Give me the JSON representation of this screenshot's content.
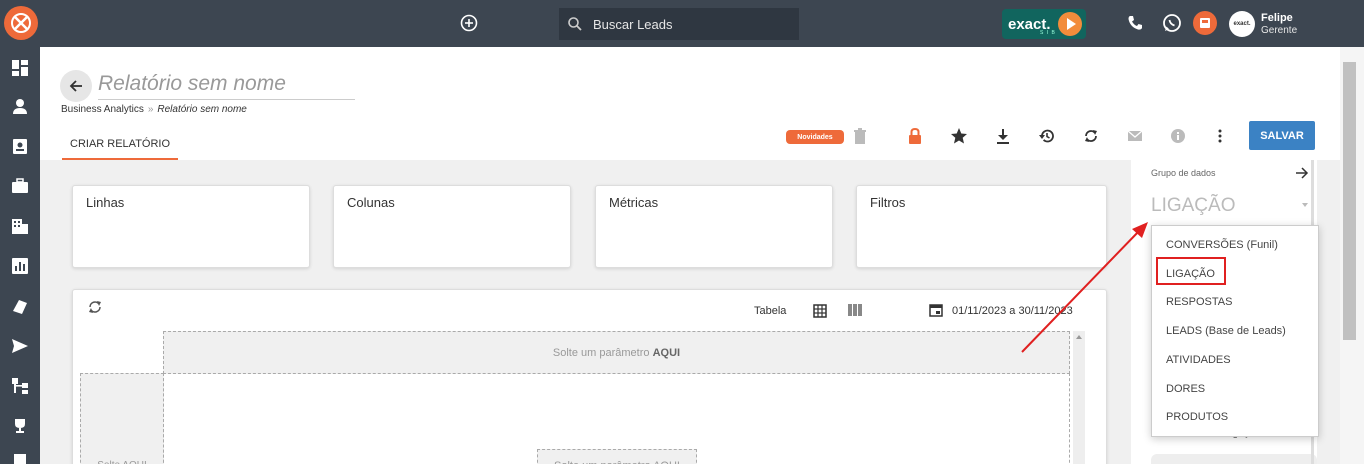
{
  "topbar": {
    "search_placeholder": "Buscar Leads",
    "brand": "exact.",
    "brand_sub": "S I B",
    "user_name": "Felipe",
    "user_role": "Gerente",
    "avatar_text": "exact."
  },
  "header": {
    "title": "Relatório sem nome",
    "breadcrumb_root": "Business Analytics",
    "breadcrumb_sep": "»",
    "breadcrumb_current": "Relatório sem nome",
    "tab_label": "CRIAR RELATÓRIO",
    "novidades_label": "Novidades",
    "save_label": "SALVAR"
  },
  "cards": [
    "Linhas",
    "Colunas",
    "Métricas",
    "Filtros"
  ],
  "table": {
    "view_label": "Tabela",
    "date_range": "01/11/2023 a 30/11/2023",
    "drop_top": "Solte um parâmetro",
    "drop_top_strong": "AQUI",
    "drop_left": "Solte AQUI",
    "drop_center": "Solte um parâmetro AQUI"
  },
  "right_panel": {
    "group_label": "Grupo de dados",
    "selected": "LIGAÇÃO",
    "under_text": "Resultado de Ligação"
  },
  "dropdown": {
    "options": [
      "CONVERSÕES (Funil)",
      "LIGAÇÃO",
      "RESPOSTAS",
      "LEADS (Base de Leads)",
      "ATIVIDADES",
      "DORES",
      "PRODUTOS"
    ],
    "highlighted": "LIGAÇÃO"
  },
  "colors": {
    "topbar": "#3d4651",
    "accent": "#ee6a3a",
    "save": "#3b82c4",
    "highlight": "#e02020"
  }
}
